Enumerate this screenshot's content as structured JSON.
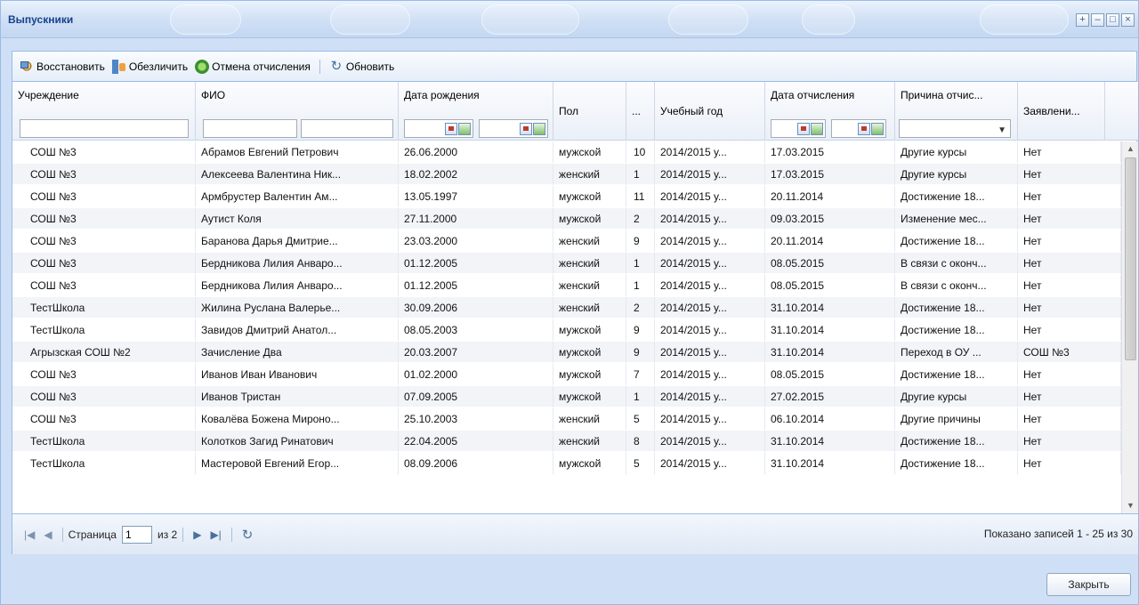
{
  "window": {
    "title": "Выпускники",
    "controls": [
      "+",
      "–",
      "□",
      "×"
    ]
  },
  "toolbar": {
    "restore": "Восстановить",
    "anonymize": "Обезличить",
    "cancel_expulsion": "Отмена отчисления",
    "refresh": "Обновить"
  },
  "columns": {
    "institution": "Учреждение",
    "fio": "ФИО",
    "birth_date": "Дата рождения",
    "sex": "Пол",
    "class": "...",
    "school_year": "Учебный год",
    "expulsion_date": "Дата отчисления",
    "reason": "Причина отчис...",
    "application": "Заявлени..."
  },
  "rows": [
    {
      "inst": "СОШ №3",
      "fio": "Абрамов Евгений Петрович",
      "birth": "26.06.2000",
      "sex": "мужской",
      "cls": "10",
      "year": "2014/2015 у...",
      "exp": "17.03.2015",
      "reason": "Другие курсы",
      "app": "Нет"
    },
    {
      "inst": "СОШ №3",
      "fio": "Алексеева Валентина Ник...",
      "birth": "18.02.2002",
      "sex": "женский",
      "cls": "1",
      "year": "2014/2015 у...",
      "exp": "17.03.2015",
      "reason": "Другие курсы",
      "app": "Нет"
    },
    {
      "inst": "СОШ №3",
      "fio": "Армбрустер Валентин Ам...",
      "birth": "13.05.1997",
      "sex": "мужской",
      "cls": "11",
      "year": "2014/2015 у...",
      "exp": "20.11.2014",
      "reason": "Достижение 18...",
      "app": "Нет"
    },
    {
      "inst": "СОШ №3",
      "fio": "Аутист Коля",
      "birth": "27.11.2000",
      "sex": "мужской",
      "cls": "2",
      "year": "2014/2015 у...",
      "exp": "09.03.2015",
      "reason": "Изменение мес...",
      "app": "Нет"
    },
    {
      "inst": "СОШ №3",
      "fio": "Баранова Дарья Дмитрие...",
      "birth": "23.03.2000",
      "sex": "женский",
      "cls": "9",
      "year": "2014/2015 у...",
      "exp": "20.11.2014",
      "reason": "Достижение 18...",
      "app": "Нет"
    },
    {
      "inst": "СОШ №3",
      "fio": "Бердникова Лилия Анваро...",
      "birth": "01.12.2005",
      "sex": "женский",
      "cls": "1",
      "year": "2014/2015 у...",
      "exp": "08.05.2015",
      "reason": "В связи с оконч...",
      "app": "Нет"
    },
    {
      "inst": "СОШ №3",
      "fio": "Бердникова Лилия Анваро...",
      "birth": "01.12.2005",
      "sex": "женский",
      "cls": "1",
      "year": "2014/2015 у...",
      "exp": "08.05.2015",
      "reason": "В связи с оконч...",
      "app": "Нет"
    },
    {
      "inst": "ТестШкола",
      "fio": "Жилина Руслана Валерье...",
      "birth": "30.09.2006",
      "sex": "женский",
      "cls": "2",
      "year": "2014/2015 у...",
      "exp": "31.10.2014",
      "reason": "Достижение 18...",
      "app": "Нет"
    },
    {
      "inst": "ТестШкола",
      "fio": "Завидов Дмитрий Анатол...",
      "birth": "08.05.2003",
      "sex": "мужской",
      "cls": "9",
      "year": "2014/2015 у...",
      "exp": "31.10.2014",
      "reason": "Достижение 18...",
      "app": "Нет"
    },
    {
      "inst": "Агрызская СОШ №2",
      "fio": "Зачисление Два",
      "birth": "20.03.2007",
      "sex": "мужской",
      "cls": "9",
      "year": "2014/2015 у...",
      "exp": "31.10.2014",
      "reason": "Переход в ОУ ...",
      "app": "СОШ №3"
    },
    {
      "inst": "СОШ №3",
      "fio": "Иванов Иван Иванович",
      "birth": "01.02.2000",
      "sex": "мужской",
      "cls": "7",
      "year": "2014/2015 у...",
      "exp": "08.05.2015",
      "reason": "Достижение 18...",
      "app": "Нет"
    },
    {
      "inst": "СОШ №3",
      "fio": "Иванов Тристан",
      "birth": "07.09.2005",
      "sex": "мужской",
      "cls": "1",
      "year": "2014/2015 у...",
      "exp": "27.02.2015",
      "reason": "Другие курсы",
      "app": "Нет"
    },
    {
      "inst": "СОШ №3",
      "fio": "Ковалёва Божена Мироно...",
      "birth": "25.10.2003",
      "sex": "женский",
      "cls": "5",
      "year": "2014/2015 у...",
      "exp": "06.10.2014",
      "reason": "Другие причины",
      "app": "Нет"
    },
    {
      "inst": "ТестШкола",
      "fio": "Колотков Загид Ринатович",
      "birth": "22.04.2005",
      "sex": "женский",
      "cls": "8",
      "year": "2014/2015 у...",
      "exp": "31.10.2014",
      "reason": "Достижение 18...",
      "app": "Нет"
    },
    {
      "inst": "ТестШкола",
      "fio": "Мастеровой Евгений Егор...",
      "birth": "08.09.2006",
      "sex": "мужской",
      "cls": "5",
      "year": "2014/2015 у...",
      "exp": "31.10.2014",
      "reason": "Достижение 18...",
      "app": "Нет"
    }
  ],
  "pager": {
    "page_label": "Страница",
    "page_value": "1",
    "of_label": "из 2",
    "info": "Показано записей 1 - 25 из 30"
  },
  "footer": {
    "close": "Закрыть"
  }
}
